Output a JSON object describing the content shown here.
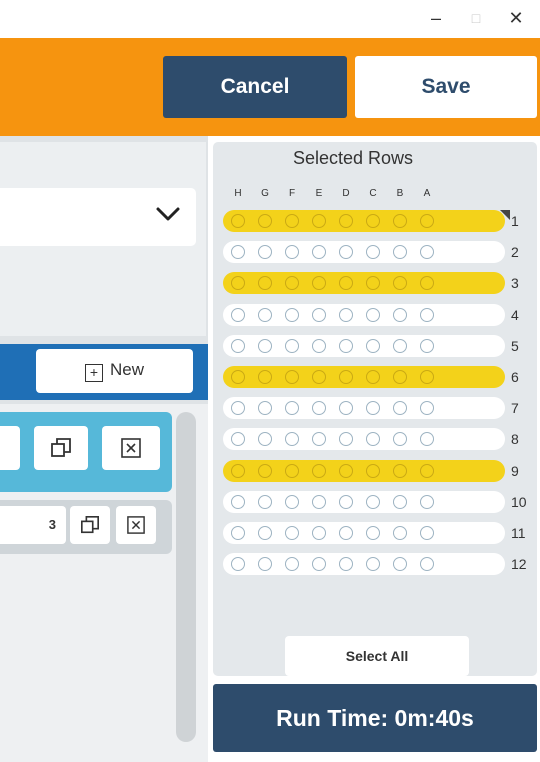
{
  "window": {
    "minimize_glyph": "–",
    "maximize_glyph": "□",
    "close_glyph": "✕"
  },
  "toolbar": {
    "cancel_label": "Cancel",
    "save_label": "Save"
  },
  "left": {
    "dropdown": {
      "icon": "chevron-down-icon",
      "glyph": "⌄"
    },
    "new_label": "New",
    "card2_label": "3"
  },
  "selected_rows": {
    "title": "Selected Rows",
    "columns": [
      "H",
      "G",
      "F",
      "E",
      "D",
      "C",
      "B",
      "A"
    ],
    "rows": [
      {
        "label": "1",
        "selected": true
      },
      {
        "label": "2",
        "selected": false
      },
      {
        "label": "3",
        "selected": true
      },
      {
        "label": "4",
        "selected": false
      },
      {
        "label": "5",
        "selected": false
      },
      {
        "label": "6",
        "selected": true
      },
      {
        "label": "7",
        "selected": false
      },
      {
        "label": "8",
        "selected": false
      },
      {
        "label": "9",
        "selected": true
      },
      {
        "label": "10",
        "selected": false
      },
      {
        "label": "11",
        "selected": false
      },
      {
        "label": "12",
        "selected": false
      }
    ],
    "select_all_label": "Select All"
  },
  "run_time": "Run Time: 0m:40s",
  "colors": {
    "orange": "#f6940f",
    "navy": "#2e4c6c",
    "selected_yellow": "#f3d21a",
    "blue": "#1f6fb6",
    "card_cyan": "#56b8d9"
  }
}
